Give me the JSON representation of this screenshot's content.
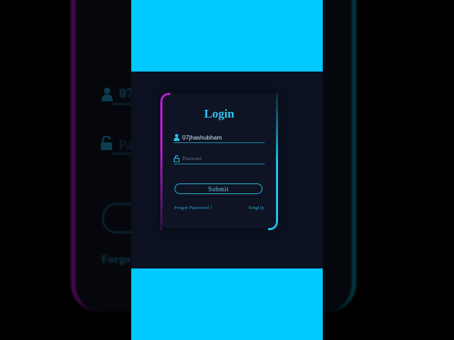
{
  "background": {
    "username_text": "07",
    "password_text": "Pa",
    "forgot_text": "Forgo"
  },
  "login": {
    "title": "Login",
    "username_value": "07jhashubham",
    "password_placeholder": "Password",
    "submit_label": "Submit",
    "forgot_label": "Forgot Password ?",
    "signup_label": "SingUp"
  },
  "colors": {
    "frame": "#00c9ff",
    "screen": "#0b1120",
    "accent_cyan": "#2fc3f2",
    "accent_magenta": "#c21bd6"
  },
  "icons": {
    "user": "user-icon",
    "lock": "unlock-icon"
  }
}
